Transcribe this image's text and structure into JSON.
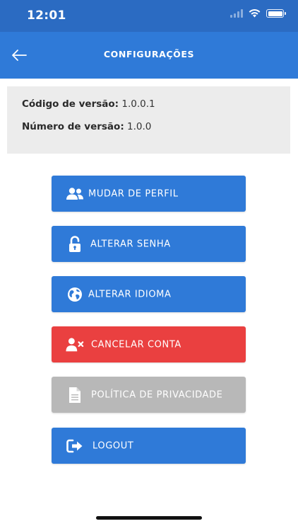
{
  "status_bar": {
    "time": "12:01"
  },
  "nav": {
    "title": "CONFIGURAÇÕES"
  },
  "info": {
    "version_code_label": "Código de versão:",
    "version_code_value": "1.0.0.1",
    "version_number_label": "Número de versão:",
    "version_number_value": "1.0.0"
  },
  "menu": {
    "change_profile": "MUDAR DE PERFIL",
    "change_password": "ALTERAR SENHA",
    "change_language": "ALTERAR IDIOMA",
    "cancel_account": "CANCELAR CONTA",
    "privacy_policy": "POLÍTICA DE PRIVACIDADE",
    "logout": "LOGOUT"
  },
  "colors": {
    "status_bar": "#2b6bc2",
    "primary": "#2f7ad8",
    "danger": "#ea4040",
    "disabled": "#b8b8b8",
    "panel": "#ececec"
  }
}
